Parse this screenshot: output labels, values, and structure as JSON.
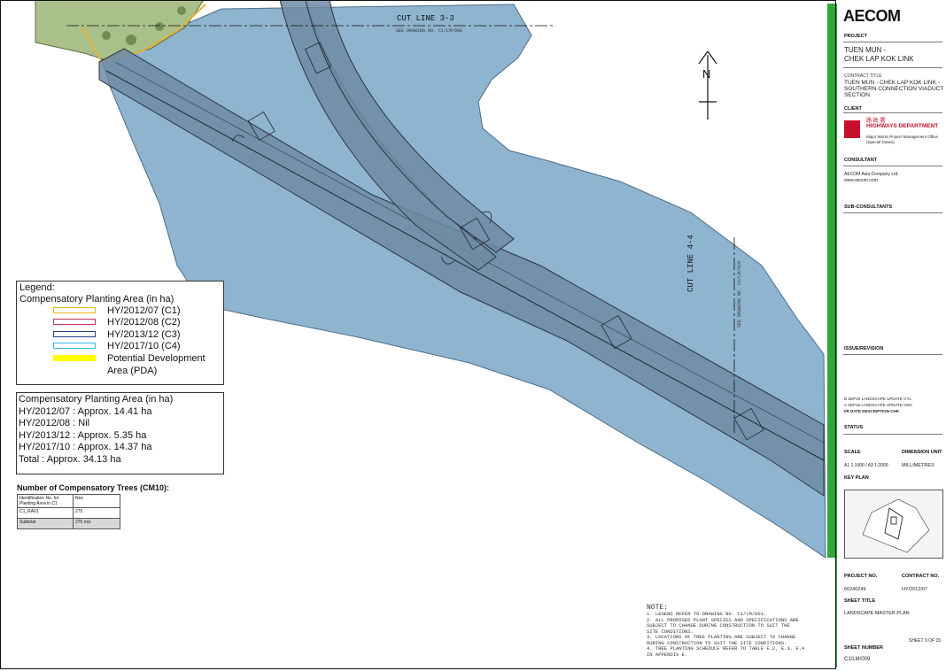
{
  "brand": "AECOM",
  "cut_line_3": {
    "label": "CUT LINE 3-3",
    "ref": "SEE DRAWING NO. C1/LM/008"
  },
  "cut_line_4": {
    "label": "CUT LINE 4-4",
    "ref": "SEE DRAWING NO. C1/LM/010"
  },
  "north_label": "N",
  "legend": {
    "title": "Legend:",
    "subtitle": "Compensatory Planting Area (in ha)",
    "items": [
      {
        "label": "HY/2012/07 (C1)",
        "color": "#e8b820"
      },
      {
        "label": "HY/2012/08 (C2)",
        "color": "#b8305a"
      },
      {
        "label": "HY/2013/12 (C3)",
        "color": "#2a3e8c"
      },
      {
        "label": "HY/2017/10 (C4)",
        "color": "#38b8e0"
      },
      {
        "label": "Potential Development",
        "label2": "Area (PDA)",
        "color": "#ffff00"
      }
    ]
  },
  "area_summary": {
    "title": "Compensatory Planting Area (in ha)",
    "lines": [
      "HY/2012/07 :  Approx. 14.41 ha",
      "HY/2012/08 :  Nil",
      "HY/2013/12 :  Approx. 5.35 ha",
      "HY/2017/10 :  Approx. 14.37 ha",
      "Total : Approx. 34.13 ha"
    ]
  },
  "trees": {
    "title": "Number of Compensatory Trees (CM10):",
    "header": [
      "Identification No. for Planting Area in C1",
      "Nos"
    ],
    "rows": [
      [
        "C1_RA01",
        "275"
      ]
    ],
    "subtotal": [
      "Subtotal",
      "275 nos"
    ]
  },
  "notes": {
    "title": "NOTE:",
    "lines": [
      "1. LEGEND REFER TO DRAWING NO. C1/LM/001.",
      "2. ALL PROPOSED PLANT SPECIES AND SPECIFICATIONS ARE",
      "   SUBJECT TO CHANGE DURING CONSTRUCTION TO SUIT THE",
      "   SITE CONDITIONS.",
      "3. LOCATIONS OF TREE PLANTING ARE SUBJECT TO CHANGE",
      "   DURING CONSTRUCTION TO SUIT THE SITE CONDITIONS.",
      "4. TREE PLANTING SCHEDULE REFER TO TABLE E.2, E.3, E.4",
      "   IN APPENDIX E."
    ]
  },
  "title_block": {
    "project_label": "PROJECT",
    "project_line1": "TUEN MUN -",
    "project_line2": "CHEK LAP KOK LINK",
    "contract_title_label": "CONTRACT TITLE",
    "contract_title_line1": "TUEN MUN - CHEK LAP KOK LINK -",
    "contract_title_line2": "SOUTHERN CONNECTION VIADUCT",
    "contract_title_line3": "SECTION",
    "client_label": "CLIENT",
    "client_zh": "路 政 署",
    "client_en": "HIGHWAYS DEPARTMENT",
    "client_sub1": "Major Works Project Management Office",
    "client_sub2": "(Special Duties)",
    "consultant_label": "CONSULTANT",
    "consultant_name": "AECOM Asia Company Ltd.",
    "consultant_web": "www.aecom.com",
    "subconsultants_label": "SUB-CONSULTANTS",
    "issue_label": "ISSUE/REVISION",
    "issue_rows": [
      [
        "B",
        "SEP16",
        "LANDSCAPE UPDATE",
        "CYL"
      ],
      [
        "A",
        "SEP16",
        "LANDSCAPE UPDATE",
        "CMA"
      ]
    ],
    "issue_header": [
      "I/R",
      "DATE",
      "DESCRIPTION",
      "CHK"
    ],
    "status_label": "STATUS",
    "scale_label": "SCALE",
    "dimension_label": "DIMENSION UNIT",
    "scale_value": "A1 1:1000 / A3 1:2000",
    "dimension_value": "MILLIMETRES",
    "keyplan_label": "KEY PLAN",
    "project_no_label": "PROJECT NO.",
    "contract_no_label": "CONTRACT NO.",
    "project_no": "60240249",
    "contract_no": "HY/2012/07",
    "sheet_title_label": "SHEET TITLE",
    "sheet_title": "LANDSCAPE MASTER PLAN",
    "sheet_of": "SHEET 9 OF 15",
    "sheet_number_label": "SHEET NUMBER",
    "sheet_number": "C1/LM/009"
  }
}
